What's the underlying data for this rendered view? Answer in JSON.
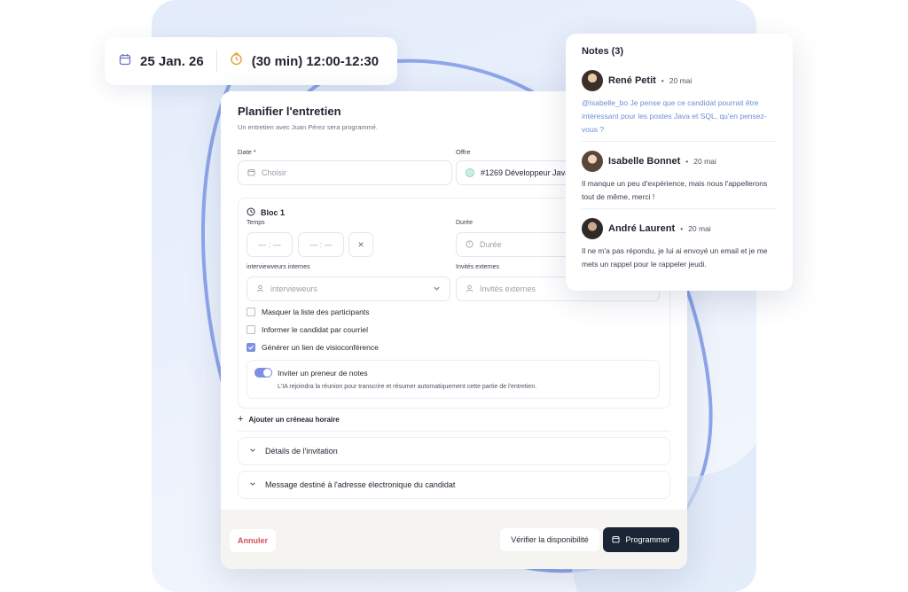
{
  "datetime": {
    "date": "25 Jan. 26",
    "time": "(30 min) 12:00-12:30"
  },
  "modal": {
    "title": "Planifier l'entretien",
    "subtitle": "Un entretien avec Juan Pérez sera programmé.",
    "date_label": "Date *",
    "date_placeholder": "Choisir",
    "offer_label": "Offre",
    "offer_value": "#1269 Développeur Java",
    "bloc": {
      "title": "Bloc 1",
      "temps_label": "Temps",
      "time_start": "— : —",
      "time_end": "— : —",
      "duree_label": "Durée",
      "duree_placeholder": "Durée",
      "internal_label": "interviewveurs internes",
      "internal_placeholder": "intervieweurs",
      "external_label": "Invités externes",
      "external_placeholder": "Invités externes",
      "checks": [
        {
          "label": "Masquer la liste des participants",
          "checked": false
        },
        {
          "label": "Informer le candidat par courriel",
          "checked": false
        },
        {
          "label": "Générer un lien de visioconférence",
          "checked": true
        }
      ],
      "notetaker_title": "Inviter un preneur de notes",
      "notetaker_desc": "L'IA rejoindra la réunion pour transcrire et résumer automatiquement cette partie de l'entretien."
    },
    "add_slot": "Ajouter un créneau horaire",
    "accordions": [
      "Détails de l'invitation",
      "Message destiné à l'adresse électronique du candidat"
    ],
    "buttons": {
      "cancel": "Annuler",
      "verify": "Vérifier la disponibilité",
      "schedule": "Programmer"
    }
  },
  "notes": {
    "title": "Notes (3)",
    "items": [
      {
        "name": "René Petit",
        "date": "20 mai",
        "text": "@Isabelle_bo Je pense que ce candidat pourrait être intéressant pour les postes Java et SQL, qu'en pensez-vous ?",
        "mention": true
      },
      {
        "name": "Isabelle Bonnet",
        "date": "20 mai",
        "text": "Il manque un peu d'expérience, mais nous l'appellerons tout de même, merci !",
        "mention": false
      },
      {
        "name": "André Laurent",
        "date": "20 mai",
        "text": "Il ne m'a pas répondu, je lui ai envoyé un email et je me mets un rappel pour le rappeler jeudi.",
        "mention": false
      }
    ]
  },
  "colors": {
    "accent": "#7d8fe0",
    "dark": "#1c2536",
    "danger": "#d3505a",
    "mention": "#6d8fd6"
  }
}
